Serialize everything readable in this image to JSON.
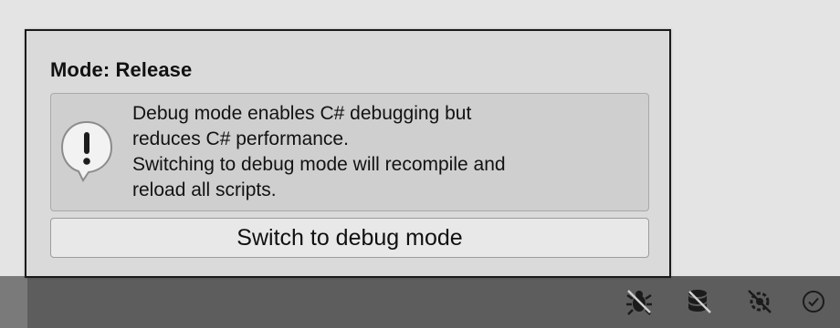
{
  "popup": {
    "title": "Mode: Release",
    "message_lines": [
      "Debug mode enables C# debugging but",
      "reduces C# performance.",
      "Switching to debug mode will recompile and",
      "reload all scripts."
    ],
    "icon": "warning-exclamation-icon",
    "button_label": "Switch to debug mode"
  },
  "status_bar": {
    "icons": [
      "debug-bug-icon",
      "cache-server-icon",
      "auto-generate-lighting-icon",
      "checkmark-circle-icon"
    ]
  },
  "colors": {
    "page_background": "#e4e4e4",
    "popup_background": "#dadada",
    "popup_border": "#1a1a1a",
    "help_box_background": "#cfcfcf",
    "button_background": "#e8e8e8",
    "status_bar_background": "#5d5d5d"
  }
}
